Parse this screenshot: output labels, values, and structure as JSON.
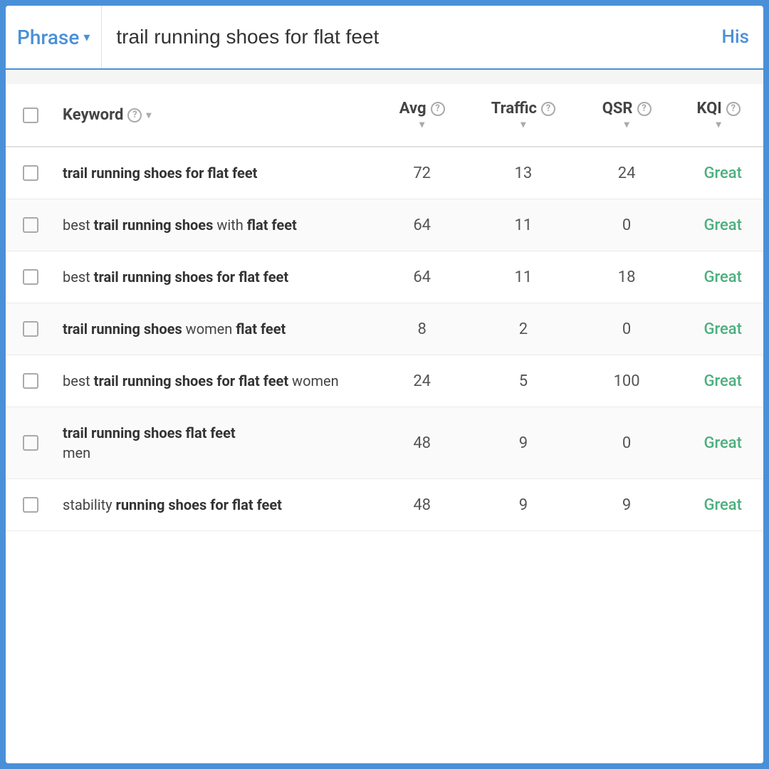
{
  "header": {
    "phrase_label": "Phrase",
    "chevron": "▾",
    "search_value": "trail running shoes for flat feet",
    "history_label": "His"
  },
  "table": {
    "columns": [
      {
        "id": "keyword",
        "label": "Keyword"
      },
      {
        "id": "avg",
        "label": "Avg"
      },
      {
        "id": "traffic",
        "label": "Traffic"
      },
      {
        "id": "qsr",
        "label": "QSR"
      },
      {
        "id": "kqi",
        "label": "KQI"
      }
    ],
    "rows": [
      {
        "id": 1,
        "keyword_parts": [
          {
            "text": "trail running shoes for flat ",
            "bold": true
          },
          {
            "text": "feet",
            "bold": true
          }
        ],
        "keyword_display": "trail running shoes for flat feet",
        "avg": "72",
        "traffic": "13",
        "qsr": "24",
        "kqi": "Great"
      },
      {
        "id": 2,
        "keyword_display": "best trail running shoes with flat feet",
        "avg": "64",
        "traffic": "11",
        "qsr": "0",
        "kqi": "Great"
      },
      {
        "id": 3,
        "keyword_display": "best trail running shoes for flat feet",
        "avg": "64",
        "traffic": "11",
        "qsr": "18",
        "kqi": "Great"
      },
      {
        "id": 4,
        "keyword_display": "trail running shoes women flat feet",
        "avg": "8",
        "traffic": "2",
        "qsr": "0",
        "kqi": "Great"
      },
      {
        "id": 5,
        "keyword_display": "best trail running shoes for flat feet women",
        "avg": "24",
        "traffic": "5",
        "qsr": "100",
        "kqi": "Great"
      },
      {
        "id": 6,
        "keyword_display": "trail running shoes flat feet men",
        "avg": "48",
        "traffic": "9",
        "qsr": "0",
        "kqi": "Great"
      },
      {
        "id": 7,
        "keyword_display": "stability running shoes for flat feet",
        "avg": "48",
        "traffic": "9",
        "qsr": "9",
        "kqi": "Great"
      }
    ],
    "keyword_bold_terms": "trail running shoes for flat feet"
  },
  "colors": {
    "accent": "#4a90d9",
    "great": "#4caf7d"
  }
}
